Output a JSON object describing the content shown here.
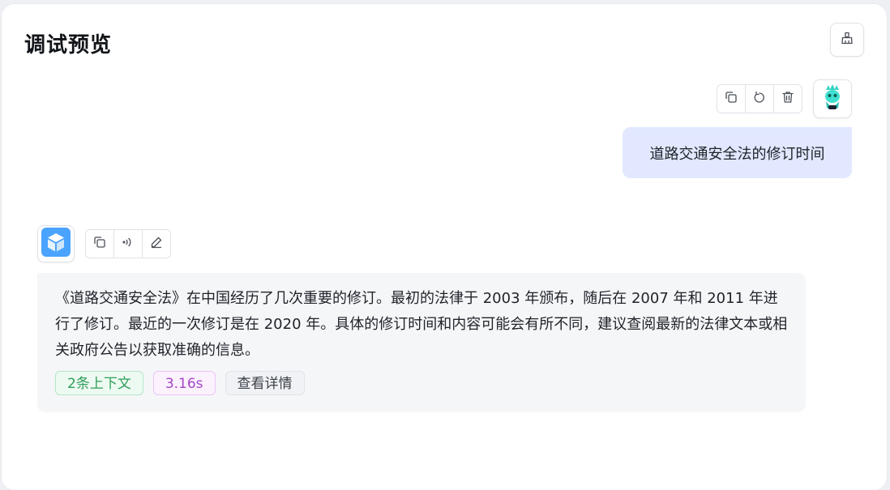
{
  "header": {
    "title": "调试预览"
  },
  "icons": {
    "clear": "broom-icon",
    "copy": "copy-icon",
    "regenerate": "refresh-icon",
    "delete": "trash-icon",
    "speak": "sound-wave-icon",
    "edit": "pencil-icon",
    "user_avatar": "user-avatar-icon",
    "bot_avatar": "cube-icon"
  },
  "conversation": {
    "user_message": "道路交通安全法的修订时间",
    "bot_message": "《道路交通安全法》在中国经历了几次重要的修订。最初的法律于 2003 年颁布，随后在 2007 年和 2011 年进行了修订。最近的一次修订是在 2020 年。具体的修订时间和内容可能会有所不同，建议查阅最新的法律文本或相关政府公告以获取准确的信息。",
    "tags": {
      "context": "2条上下文",
      "duration": "3.16s",
      "detail": "查看详情"
    }
  },
  "colors": {
    "user_bubble": "#e1e8ff",
    "bot_bubble": "#f5f6f8",
    "context_tag": "#2f9e5a",
    "duration_tag": "#a646c7",
    "bot_avatar": "#4aa3ff"
  }
}
